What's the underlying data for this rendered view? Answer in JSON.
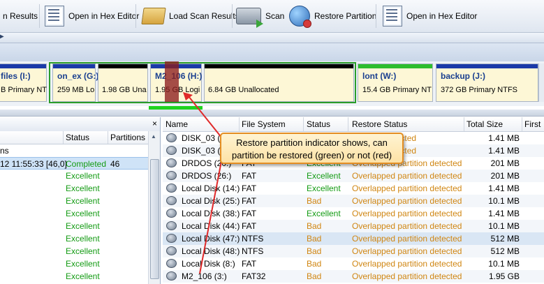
{
  "toolbar": {
    "buttons": [
      {
        "label": "n Results",
        "icon": "scan-results-icon"
      },
      {
        "label": "Open in Hex Editor",
        "icon": "hex-editor-icon"
      },
      {
        "label": "Load Scan Results",
        "icon": "folder-icon"
      },
      {
        "label": "Scan",
        "icon": "scan-icon"
      },
      {
        "label": "Restore Partition",
        "icon": "restore-partition-icon"
      },
      {
        "label": "Open in Hex Editor",
        "icon": "hex-editor-icon"
      }
    ]
  },
  "disk_map": {
    "partitions": [
      {
        "name": "files (I:)",
        "info": "B Primary NT",
        "bar": "#1a3aa8"
      },
      {
        "name": "on_ex (G:)",
        "info": "259 MB Lo",
        "bar": "#1a3aa8"
      },
      {
        "name": "",
        "info": "1.98 GB  Una",
        "bar": "#000000"
      },
      {
        "name": "M2_106 (H:)",
        "info": "1.95 GB Logi",
        "bar": "#1a3aa8"
      },
      {
        "name": "",
        "info": "6.84 GB  Unallocated",
        "bar": "#000000"
      },
      {
        "name": "lont (W:)",
        "info": "15.4 GB Primary NT",
        "bar": "#2dbd2d"
      },
      {
        "name": "backup (J:)",
        "info": "372 GB Primary NTFS",
        "bar": "#1a3aa8"
      }
    ]
  },
  "left_panel": {
    "columns": [
      "Status",
      "Partitions"
    ],
    "rows": [
      {
        "name": "ns",
        "status": "",
        "partitions": ""
      },
      {
        "name": "12 11:55:33 [46,0]",
        "status": "Completed",
        "partitions": "46"
      },
      {
        "name": "",
        "status": "Excellent",
        "partitions": ""
      },
      {
        "name": "",
        "status": "Excellent",
        "partitions": ""
      },
      {
        "name": "",
        "status": "Excellent",
        "partitions": ""
      },
      {
        "name": "",
        "status": "Excellent",
        "partitions": ""
      },
      {
        "name": "",
        "status": "Excellent",
        "partitions": ""
      },
      {
        "name": "",
        "status": "Excellent",
        "partitions": ""
      },
      {
        "name": "",
        "status": "Excellent",
        "partitions": ""
      },
      {
        "name": "",
        "status": "Excellent",
        "partitions": ""
      },
      {
        "name": "",
        "status": "Excellent",
        "partitions": ""
      }
    ]
  },
  "right_panel": {
    "columns": [
      "Name",
      "File System",
      "Status",
      "Restore Status",
      "Total Size",
      "First"
    ],
    "rows": [
      {
        "name": "DISK_03 (21:",
        "fs": "",
        "status": "",
        "restore": "partition detected",
        "size": "1.41 MB"
      },
      {
        "name": "DISK_03 (30:",
        "fs": "",
        "status": "",
        "restore": "partition detected",
        "size": "1.41 MB"
      },
      {
        "name": "DRDOS (20:)",
        "fs": "FAT",
        "status": "Excellent",
        "restore": "Overlapped partition detected",
        "size": "201 MB"
      },
      {
        "name": "DRDOS (26:)",
        "fs": "FAT",
        "status": "Excellent",
        "restore": "Overlapped partition detected",
        "size": "201 MB"
      },
      {
        "name": "Local Disk (14:)",
        "fs": "FAT",
        "status": "Excellent",
        "restore": "Overlapped partition detected",
        "size": "1.41 MB"
      },
      {
        "name": "Local Disk (25:)",
        "fs": "FAT",
        "status": "Bad",
        "restore": "Overlapped partition detected",
        "size": "10.1 MB"
      },
      {
        "name": "Local Disk (38:)",
        "fs": "FAT",
        "status": "Excellent",
        "restore": "Overlapped partition detected",
        "size": "1.41 MB"
      },
      {
        "name": "Local Disk (44:)",
        "fs": "FAT",
        "status": "Bad",
        "restore": "Overlapped partition detected",
        "size": "10.1 MB"
      },
      {
        "name": "Local Disk (47:)",
        "fs": "NTFS",
        "status": "Bad",
        "restore": "Overlapped partition detected",
        "size": "512 MB"
      },
      {
        "name": "Local Disk (48:)",
        "fs": "NTFS",
        "status": "Bad",
        "restore": "Overlapped partition detected",
        "size": "512 MB"
      },
      {
        "name": "Local Disk (8:)",
        "fs": "FAT",
        "status": "Bad",
        "restore": "Overlapped partition detected",
        "size": "10.1 MB"
      },
      {
        "name": "M2_106 (3:)",
        "fs": "FAT32",
        "status": "Bad",
        "restore": "Overlapped partition detected",
        "size": "1.95 GB"
      }
    ]
  },
  "callout": {
    "line1": "Restore partition indicator shows, can",
    "line2": "partition be restored (green) or not (red)"
  },
  "colors": {
    "good": "#139b13",
    "warning": "#d08612",
    "indicator_green": "#1fd31f",
    "indicator_red": "#8c1e1e",
    "callout_border": "#e48e22"
  }
}
